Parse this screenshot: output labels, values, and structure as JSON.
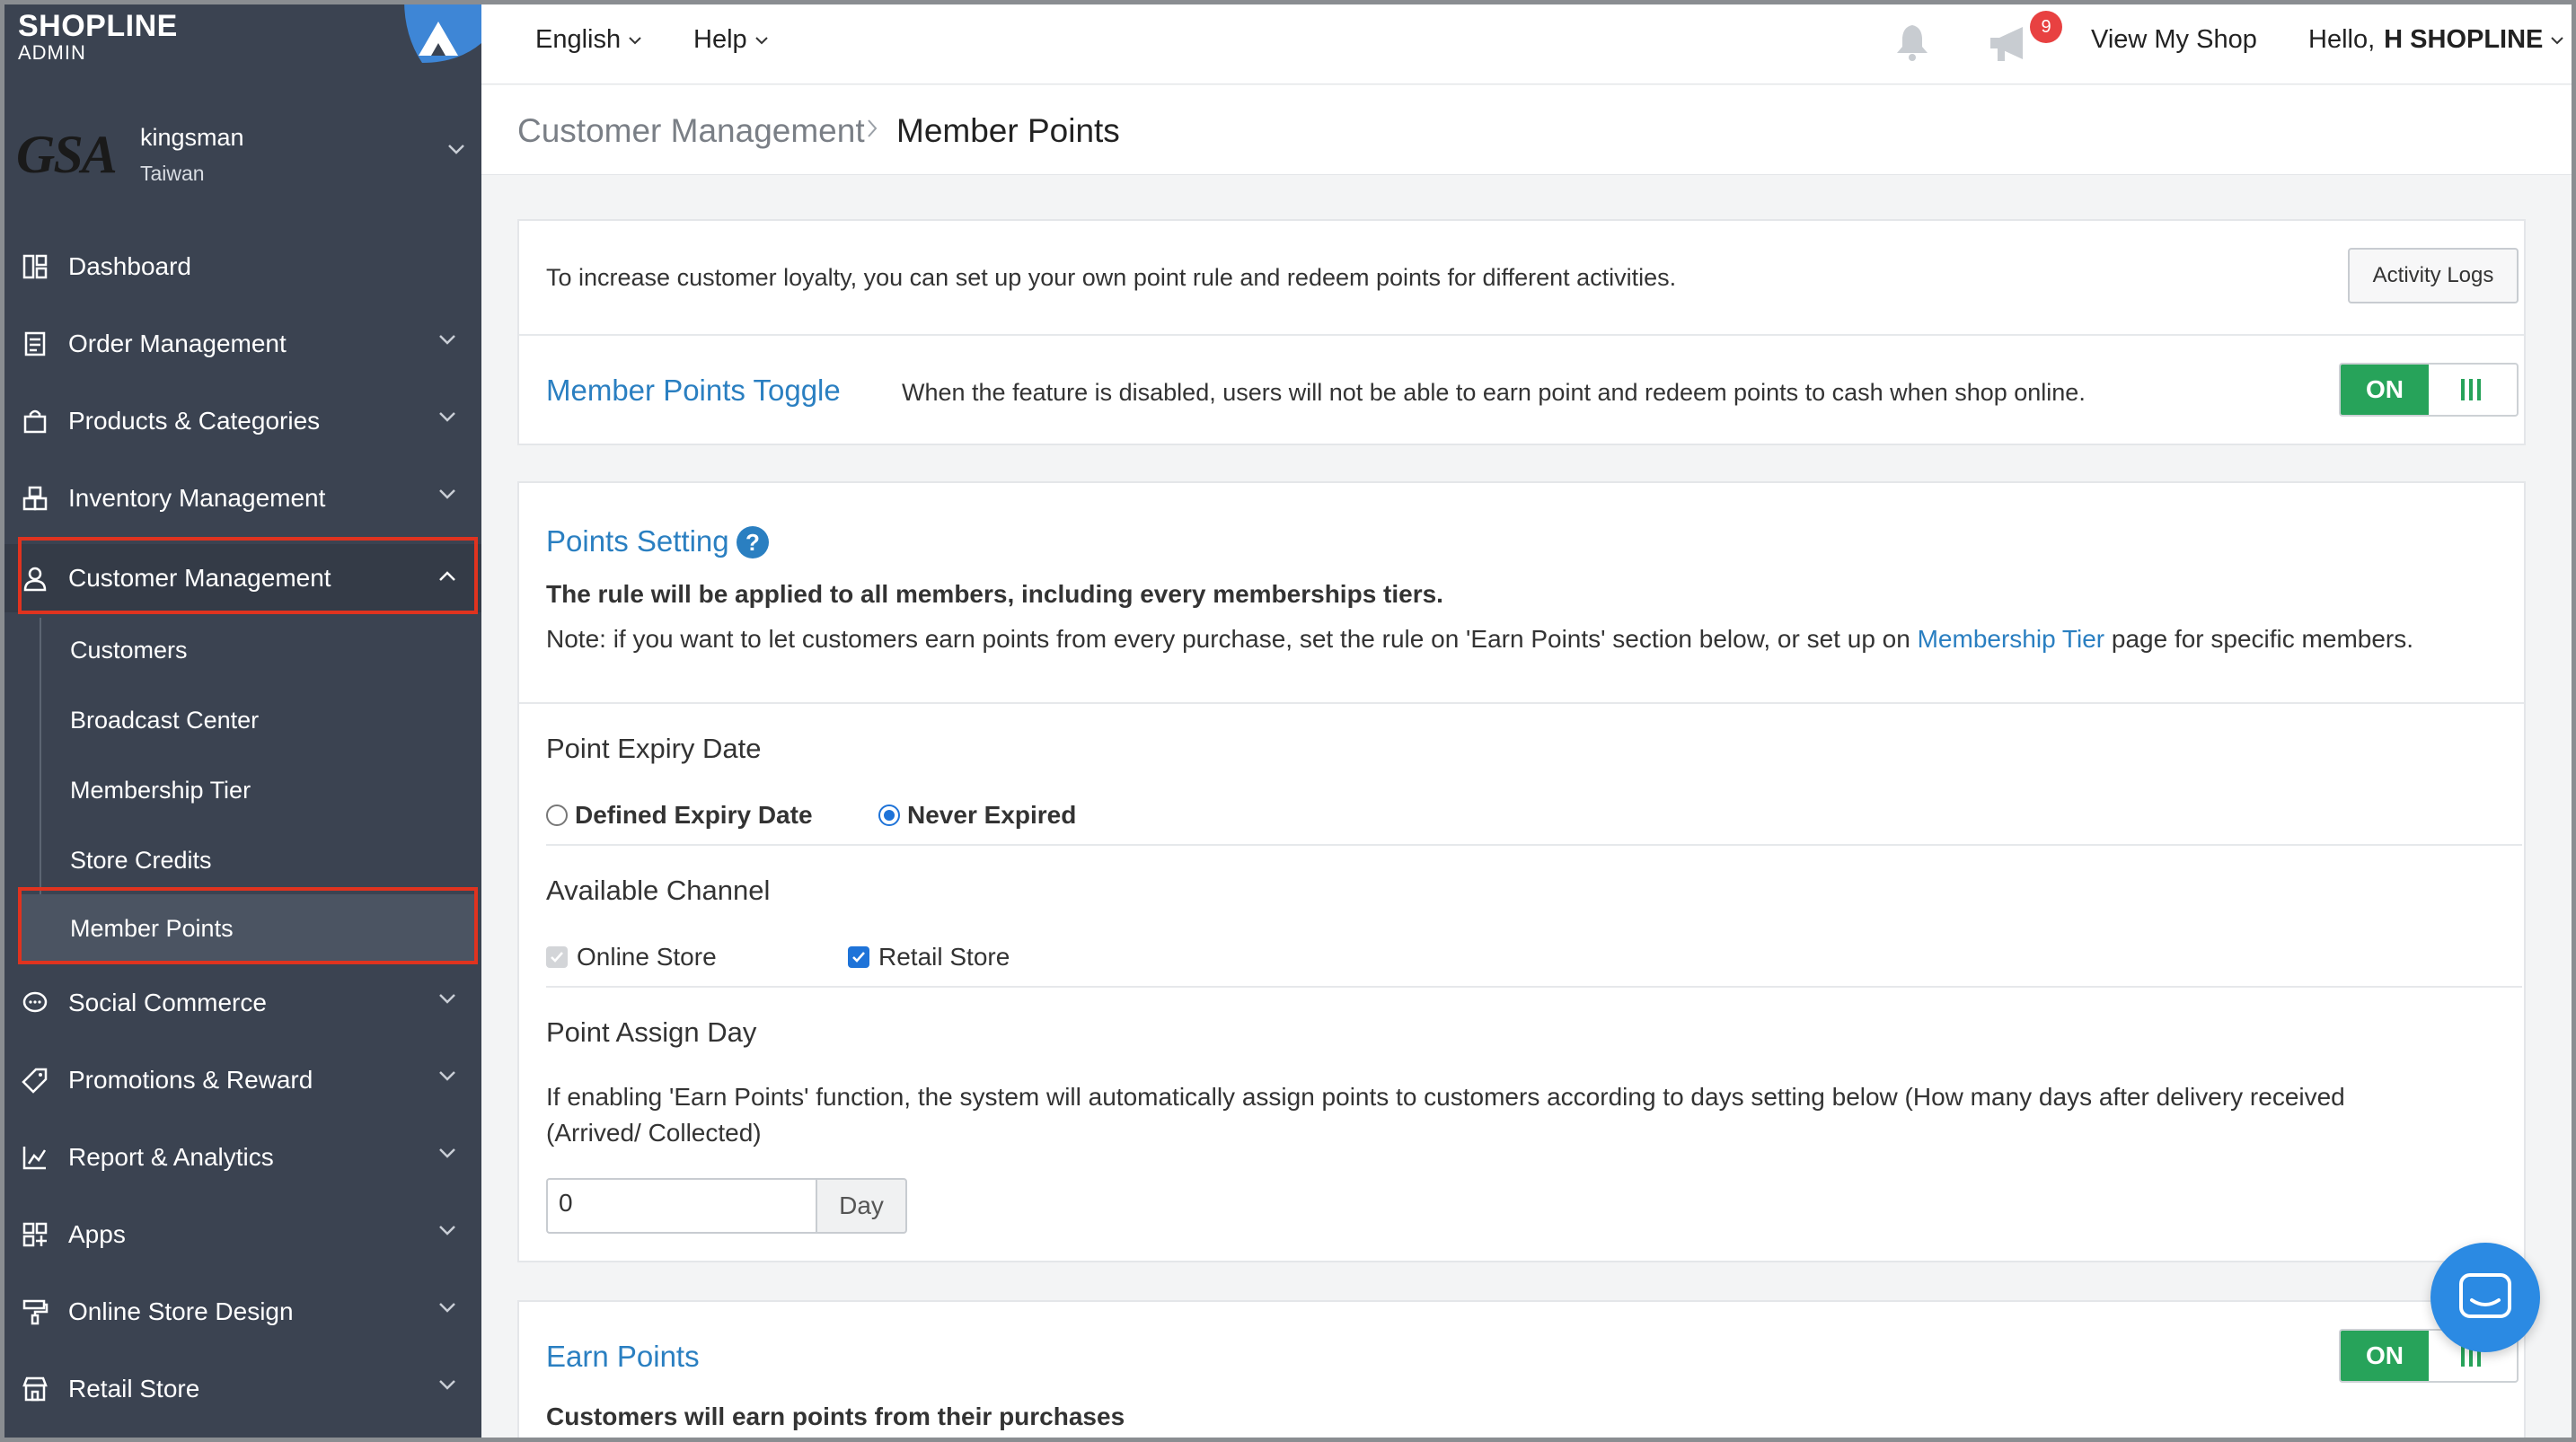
{
  "brand": {
    "name": "SHOPLINE",
    "subtitle": "ADMIN"
  },
  "shop": {
    "logo_text": "GSA",
    "name": "kingsman",
    "region": "Taiwan"
  },
  "sidebar": {
    "items": [
      {
        "label": "Dashboard",
        "icon": "dashboard-icon"
      },
      {
        "label": "Order Management",
        "icon": "order-icon"
      },
      {
        "label": "Products & Categories",
        "icon": "bag-icon"
      },
      {
        "label": "Inventory Management",
        "icon": "boxes-icon"
      },
      {
        "label": "Customer Management",
        "icon": "user-icon"
      },
      {
        "label": "Social Commerce",
        "icon": "chat-bubble-icon"
      },
      {
        "label": "Promotions & Reward",
        "icon": "tag-icon"
      },
      {
        "label": "Report & Analytics",
        "icon": "chart-icon"
      },
      {
        "label": "Apps",
        "icon": "apps-icon"
      },
      {
        "label": "Online Store Design",
        "icon": "paint-roller-icon"
      },
      {
        "label": "Retail Store",
        "icon": "store-icon"
      }
    ],
    "sub_items": [
      "Customers",
      "Broadcast Center",
      "Membership Tier",
      "Store Credits",
      "Member Points"
    ]
  },
  "topbar": {
    "language": "English",
    "help": "Help",
    "notification_count": "9",
    "view_shop": "View My Shop",
    "greeting": "Hello,",
    "user": "H SHOPLINE"
  },
  "breadcrumb": {
    "parent": "Customer Management",
    "current": "Member Points"
  },
  "intro": {
    "text": "To increase customer loyalty, you can set up your own point rule and redeem points for different activities.",
    "activity_logs": "Activity Logs"
  },
  "toggle_row": {
    "title": "Member Points Toggle",
    "description": "When the feature is disabled, users will not be able to earn point and redeem points to cash when shop online.",
    "state": "ON"
  },
  "points_setting": {
    "title": "Points Setting",
    "rule": "The rule will be applied to all members, including every memberships tiers.",
    "note_before": "Note: if you want to let customers earn points from every purchase, set the rule on 'Earn Points' section below, or set up on",
    "note_link": "Membership Tier",
    "note_after": "page for specific members.",
    "expiry": {
      "heading": "Point Expiry Date",
      "options": [
        "Defined Expiry Date",
        "Never Expired"
      ],
      "selected": "Never Expired"
    },
    "channel": {
      "heading": "Available Channel",
      "options": [
        "Online Store",
        "Retail Store"
      ]
    },
    "assign": {
      "heading": "Point Assign Day",
      "description_line1": "If enabling 'Earn Points' function, the system will automatically assign points to customers according to days setting below (How many days after delivery received",
      "description_line2": "(Arrived/ Collected)",
      "value": "0",
      "unit": "Day"
    }
  },
  "earn_points": {
    "title": "Earn Points",
    "state": "ON",
    "subtitle": "Customers will earn points from their purchases"
  },
  "colors": {
    "sidebar_bg": "#3b4351",
    "accent_link": "#2a7fc1",
    "toggle_on": "#27a35a",
    "highlight": "#e0331f",
    "badge": "#e84141"
  }
}
